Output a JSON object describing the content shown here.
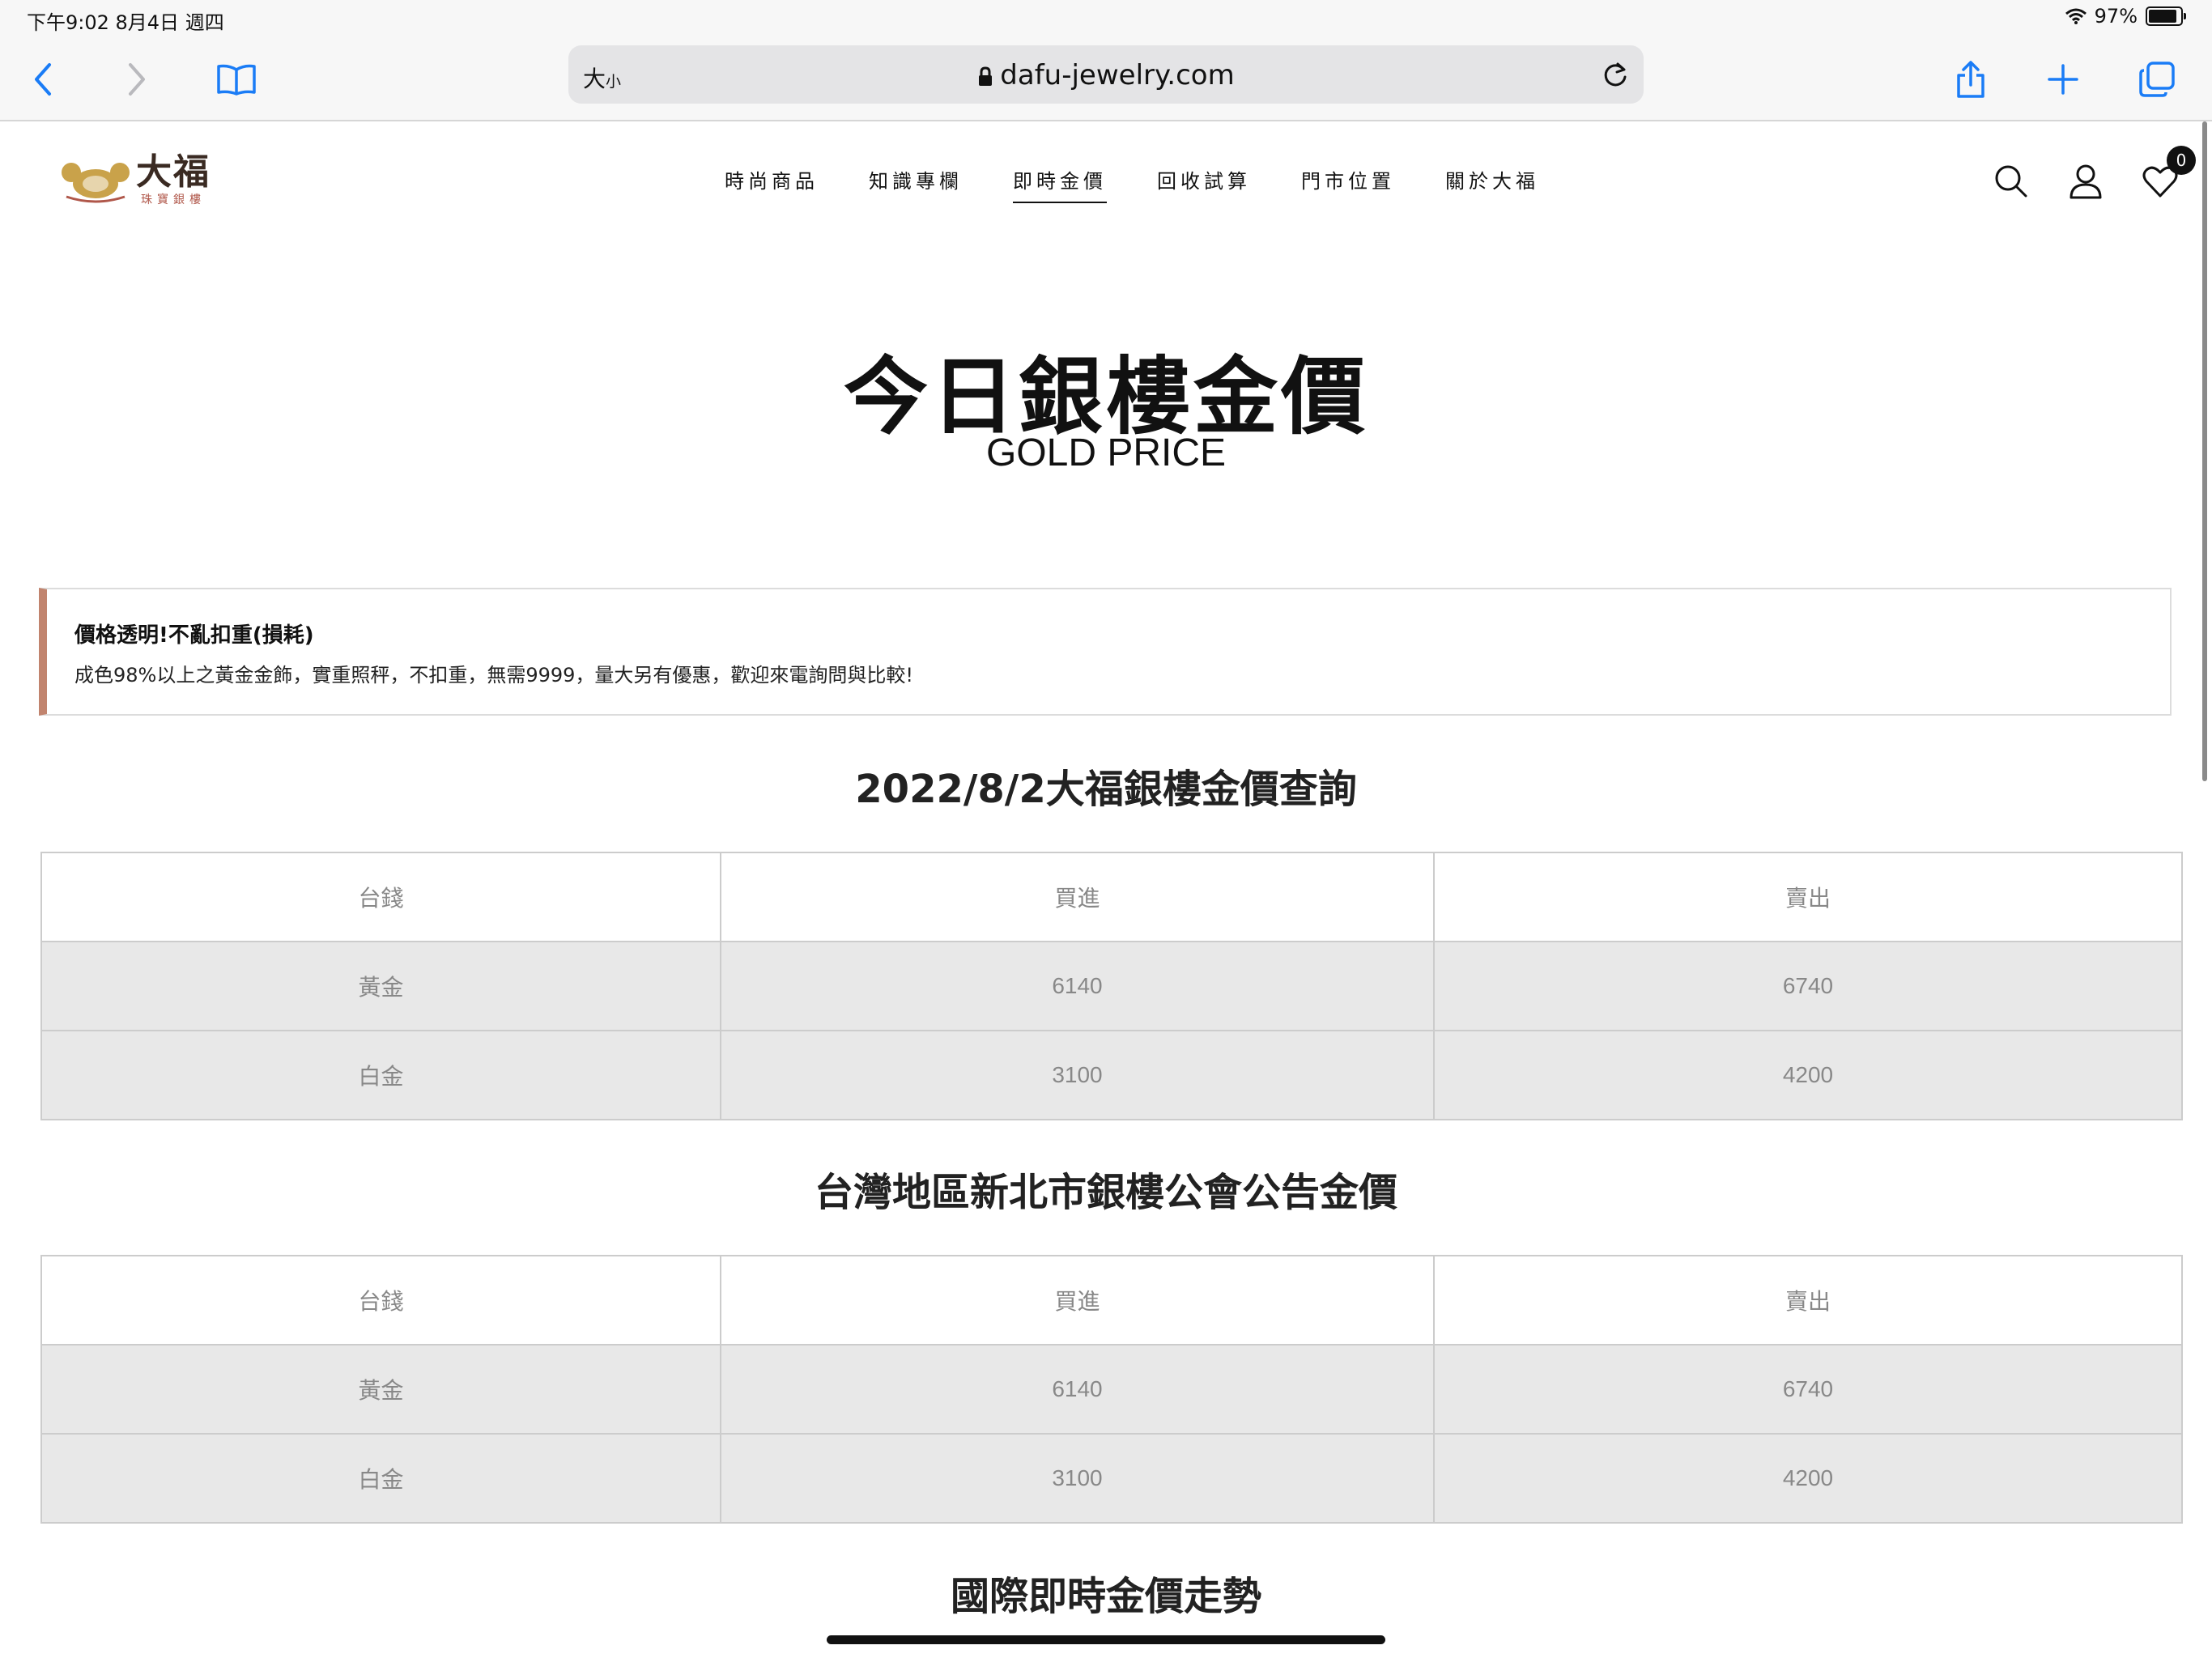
{
  "status_bar": {
    "time": "下午9:02   8月4日 週四",
    "battery": "97%"
  },
  "browser": {
    "text_size": "大",
    "text_size_small": "小",
    "url": "dafu-jewelry.com"
  },
  "site": {
    "logo_main": "大福",
    "logo_sub": "珠寶銀樓",
    "nav": [
      "時尚商品",
      "知識專欄",
      "即時金價",
      "回收試算",
      "門市位置",
      "關於大福"
    ],
    "cart_count": "0"
  },
  "hero": {
    "title": "今日銀樓金價",
    "subtitle": "GOLD PRICE"
  },
  "notice": {
    "title": "價格透明!不亂扣重(損耗)",
    "text": "成色98%以上之黃金金飾，實重照秤，不扣重，無需9999，量大另有優惠，歡迎來電詢問與比較!",
    "accent_color": "#c1846e"
  },
  "tables": [
    {
      "title": "2022/8/2大福銀樓金價查詢",
      "headers": [
        "台錢",
        "買進",
        "賣出"
      ],
      "rows": [
        [
          "黃金",
          "6140",
          "6740"
        ],
        [
          "白金",
          "3100",
          "4200"
        ]
      ]
    },
    {
      "title": "台灣地區新北市銀樓公會公告金價",
      "headers": [
        "台錢",
        "買進",
        "賣出"
      ],
      "rows": [
        [
          "黃金",
          "6140",
          "6740"
        ],
        [
          "白金",
          "3100",
          "4200"
        ]
      ]
    }
  ],
  "trend_title": "國際即時金價走勢"
}
